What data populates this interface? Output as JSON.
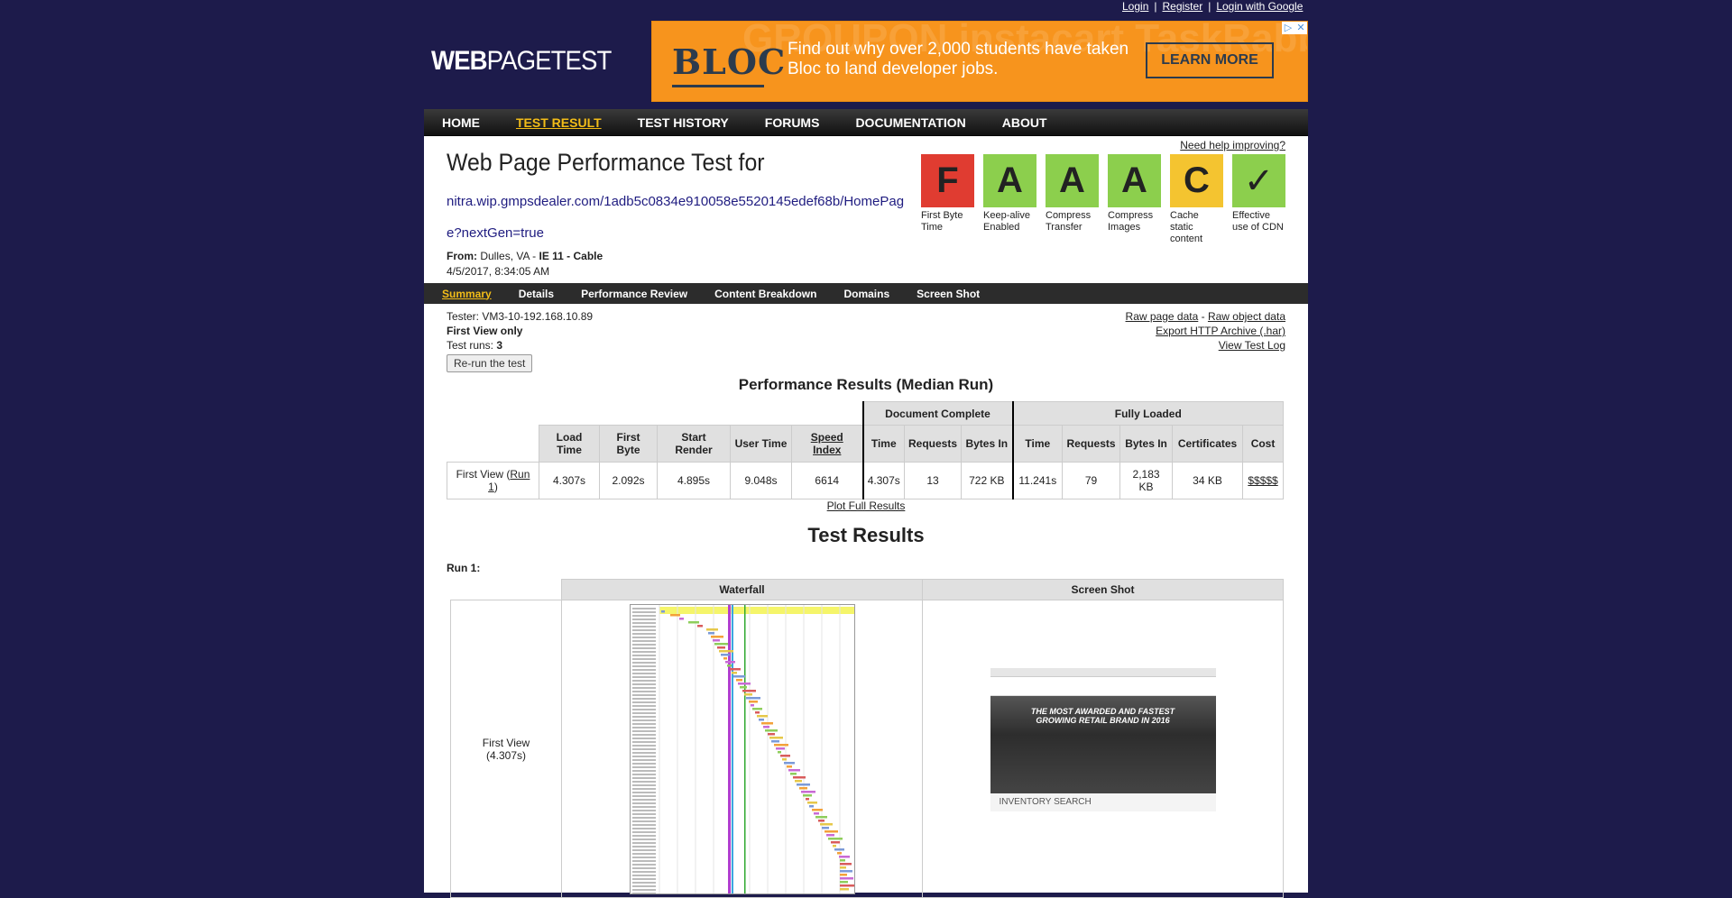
{
  "auth": {
    "login": "Login",
    "register": "Register",
    "login_google": "Login with Google",
    "sep": "|"
  },
  "logo": {
    "bold": "WEB",
    "rest": "PAGETEST"
  },
  "ad": {
    "brand": "BLOC",
    "copy": "Find out why over 2,000 students have taken Bloc to land developer jobs.",
    "cta": "LEARN MORE",
    "bg_words": "GROUPON  instacart  TaskRabbit"
  },
  "nav": {
    "items": [
      {
        "label": "HOME",
        "active": false
      },
      {
        "label": "TEST RESULT",
        "active": true
      },
      {
        "label": "TEST HISTORY",
        "active": false
      },
      {
        "label": "FORUMS",
        "active": false
      },
      {
        "label": "DOCUMENTATION",
        "active": false
      },
      {
        "label": "ABOUT",
        "active": false
      }
    ]
  },
  "header": {
    "title": "Web Page Performance Test for",
    "url": "nitra.wip.gmpsdealer.com/1adb5c0834e910058e5520145edef68b/HomePage?nextGen=true",
    "from_label": "From:",
    "from_location": "Dulles, VA - ",
    "from_browser": "IE 11 - Cable",
    "date": "4/5/2017, 8:34:05 AM",
    "help_link": "Need help improving?"
  },
  "grades": [
    {
      "letter": "F",
      "label": "First Byte Time",
      "color": "#e03c31"
    },
    {
      "letter": "A",
      "label": "Keep-alive Enabled",
      "color": "#8ccf4d"
    },
    {
      "letter": "A",
      "label": "Compress Transfer",
      "color": "#8ccf4d"
    },
    {
      "letter": "A",
      "label": "Compress Images",
      "color": "#8ccf4d"
    },
    {
      "letter": "C",
      "label": "Cache static content",
      "color": "#f4c430"
    },
    {
      "letter": "✓",
      "label": "Effective use of CDN",
      "color": "#8ccf4d"
    }
  ],
  "subnav": {
    "items": [
      {
        "label": "Summary",
        "active": true
      },
      {
        "label": "Details",
        "active": false
      },
      {
        "label": "Performance Review",
        "active": false
      },
      {
        "label": "Content Breakdown",
        "active": false
      },
      {
        "label": "Domains",
        "active": false
      },
      {
        "label": "Screen Shot",
        "active": false
      }
    ]
  },
  "tester": {
    "tester_line": "Tester: VM3-10-192.168.10.89",
    "first_view": "First View only",
    "runs_label": "Test runs: ",
    "runs_value": "3",
    "rerun_button": "Re-run the test"
  },
  "raw": {
    "raw_page": "Raw page data",
    "dash": " - ",
    "raw_object": "Raw object data",
    "export_har": "Export HTTP Archive (.har)",
    "view_log": "View Test Log"
  },
  "perf": {
    "title": "Performance Results (Median Run)",
    "group_doc": "Document Complete",
    "group_full": "Fully Loaded",
    "headers": {
      "load_time": "Load Time",
      "first_byte": "First Byte",
      "start_render": "Start Render",
      "user_time": "User Time",
      "speed_index": "Speed Index",
      "doc_time": "Time",
      "doc_requests": "Requests",
      "doc_bytes": "Bytes In",
      "full_time": "Time",
      "full_requests": "Requests",
      "full_bytes": "Bytes In",
      "certificates": "Certificates",
      "cost": "Cost"
    },
    "row": {
      "label_pre": "First View (",
      "label_link": "Run 1",
      "label_post": ")",
      "load_time": "4.307s",
      "first_byte": "2.092s",
      "start_render": "4.895s",
      "user_time": "9.048s",
      "speed_index": "6614",
      "doc_time": "4.307s",
      "doc_requests": "13",
      "doc_bytes": "722 KB",
      "full_time": "11.241s",
      "full_requests": "79",
      "full_bytes": "2,183 KB",
      "certificates": "34 KB",
      "cost": "$$$$$"
    },
    "plot_link": "Plot Full Results"
  },
  "results": {
    "title": "Test Results",
    "run_label": "Run 1:",
    "waterfall_header": "Waterfall",
    "screenshot_header": "Screen Shot",
    "first_view_label": "First View",
    "first_view_time": "(4.307s)",
    "shot_inventory": "INVENTORY SEARCH",
    "shot_hero_line1": "THE MOST AWARDED AND FASTEST",
    "shot_hero_line2": "GROWING RETAIL BRAND IN 2016"
  }
}
